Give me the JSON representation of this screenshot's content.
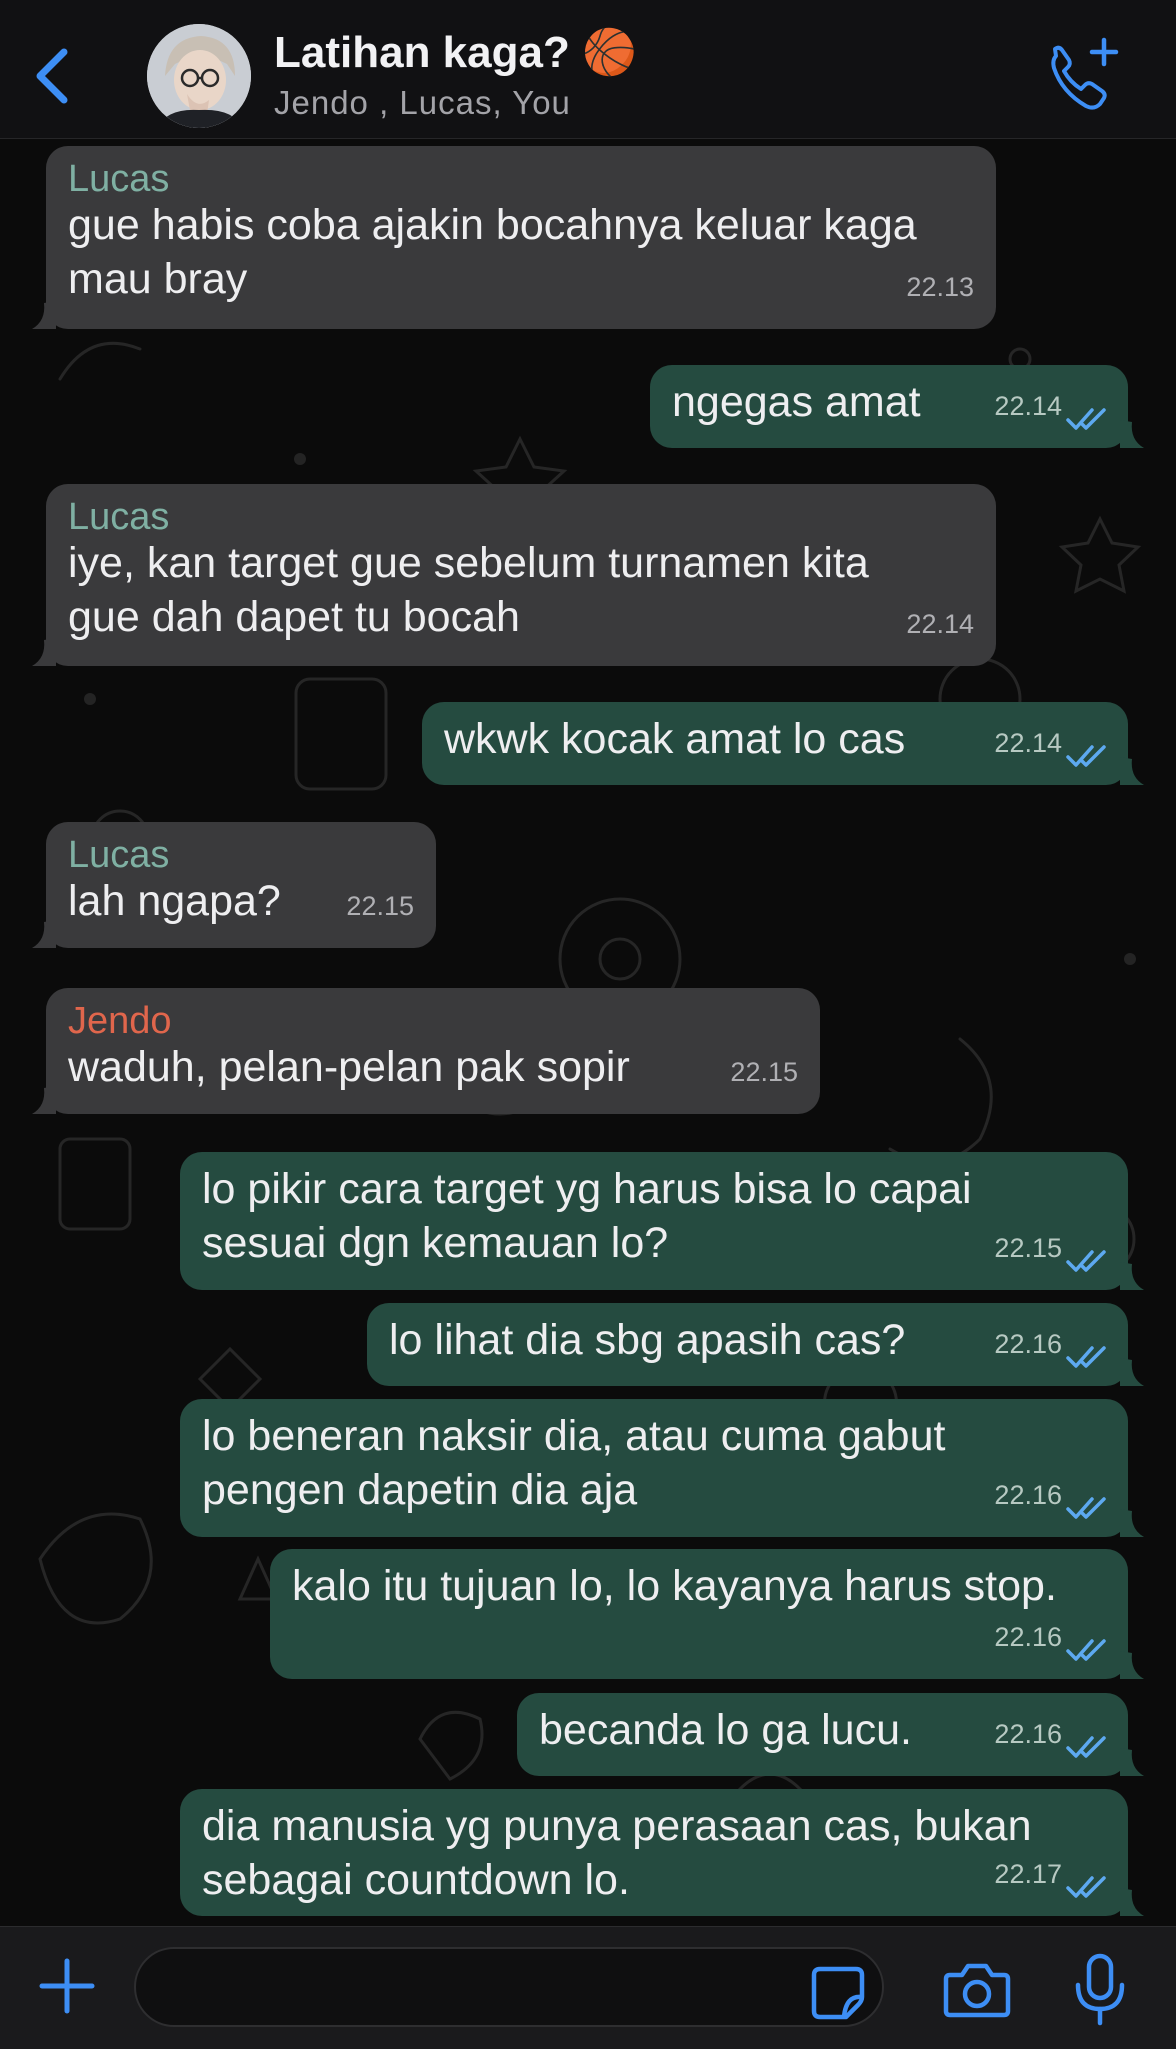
{
  "header": {
    "title": "Latihan kaga? 🏀",
    "participants": "Jendo , Lucas, You",
    "icons": {
      "back": "chevron-left-icon",
      "call": "add-call-icon"
    }
  },
  "colors": {
    "accent": "#3d8ef5",
    "incoming_bubble": "#3a3a3c",
    "outgoing_bubble": "#254b40",
    "lucas_name": "#7fb0a3",
    "jendo_name": "#e0664c",
    "read_ticks": "#5da9f0"
  },
  "messages": [
    {
      "direction": "incoming",
      "sender": "Lucas",
      "lines": [
        "gue habis coba ajakin bocahnya keluar kaga",
        "mau bray"
      ],
      "time": "22.13"
    },
    {
      "direction": "outgoing",
      "lines": [
        "ngegas amat"
      ],
      "time": "22.14",
      "status": "read"
    },
    {
      "direction": "incoming",
      "sender": "Lucas",
      "lines": [
        "iye, kan target gue sebelum turnamen kita",
        "gue dah dapet tu bocah"
      ],
      "time": "22.14"
    },
    {
      "direction": "outgoing",
      "lines": [
        "wkwk kocak amat lo cas"
      ],
      "time": "22.14",
      "status": "read"
    },
    {
      "direction": "incoming",
      "sender": "Lucas",
      "lines": [
        "lah ngapa?"
      ],
      "time": "22.15"
    },
    {
      "direction": "incoming",
      "sender": "Jendo",
      "lines": [
        "waduh, pelan-pelan pak sopir"
      ],
      "time": "22.15"
    },
    {
      "direction": "outgoing",
      "lines": [
        "lo pikir cara target yg harus bisa lo capai",
        "sesuai dgn kemauan lo?"
      ],
      "time": "22.15",
      "status": "read"
    },
    {
      "direction": "outgoing",
      "lines": [
        "lo lihat dia sbg apasih cas?"
      ],
      "time": "22.16",
      "status": "read"
    },
    {
      "direction": "outgoing",
      "lines": [
        "lo beneran naksir dia, atau cuma gabut",
        "pengen dapetin dia aja"
      ],
      "time": "22.16",
      "status": "read"
    },
    {
      "direction": "outgoing",
      "lines": [
        "kalo itu tujuan lo, lo kayanya harus stop."
      ],
      "time": "22.16",
      "status": "read"
    },
    {
      "direction": "outgoing",
      "lines": [
        "becanda lo ga lucu."
      ],
      "time": "22.16",
      "status": "read"
    },
    {
      "direction": "outgoing",
      "lines": [
        " dia manusia yg punya perasaan cas, bukan",
        "sebagai countdown lo."
      ],
      "time": "22.17",
      "status": "read"
    }
  ],
  "input_bar": {
    "placeholder": "",
    "icons": {
      "attach": "plus-icon",
      "sticker": "sticker-icon",
      "camera": "camera-icon",
      "mic": "microphone-icon"
    }
  }
}
